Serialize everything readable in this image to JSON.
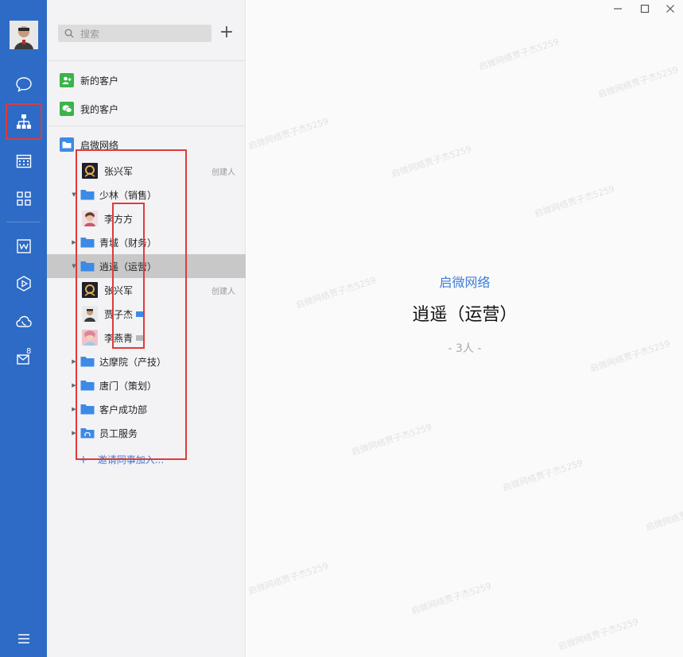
{
  "search": {
    "placeholder": "搜索"
  },
  "panel": {
    "top_items": [
      {
        "label": "新的客户"
      },
      {
        "label": "我的客户"
      }
    ],
    "org_root": "启微网络",
    "tree": [
      {
        "type": "person",
        "label": "张兴军",
        "caption": "创建人"
      },
      {
        "type": "folder",
        "label": "少林（销售）"
      },
      {
        "type": "person",
        "label": "李方方"
      },
      {
        "type": "folder",
        "label": "青城（财务）"
      },
      {
        "type": "folder",
        "label": "逍遥（运营）",
        "selected": true
      },
      {
        "type": "person",
        "label": "张兴军",
        "caption": "创建人"
      },
      {
        "type": "person",
        "label": "贾子杰"
      },
      {
        "type": "person",
        "label": "李燕青"
      },
      {
        "type": "folder",
        "label": "达摩院（产技）"
      },
      {
        "type": "folder",
        "label": "唐门（策划）"
      },
      {
        "type": "folder",
        "label": "客户成功部"
      },
      {
        "type": "folder",
        "label": "员工服务"
      }
    ],
    "invite": "邀请同事加入..."
  },
  "rail": {
    "mail_badge": "8"
  },
  "detail": {
    "org_name": "启微网络",
    "dept_name": "逍遥（运营）",
    "count": "- 3人 -"
  },
  "watermark": "启微网络贾子杰5259",
  "colors": {
    "rail": "#2d6bc6",
    "accent": "#3d7fd6",
    "highlight": "#e03a3a"
  }
}
